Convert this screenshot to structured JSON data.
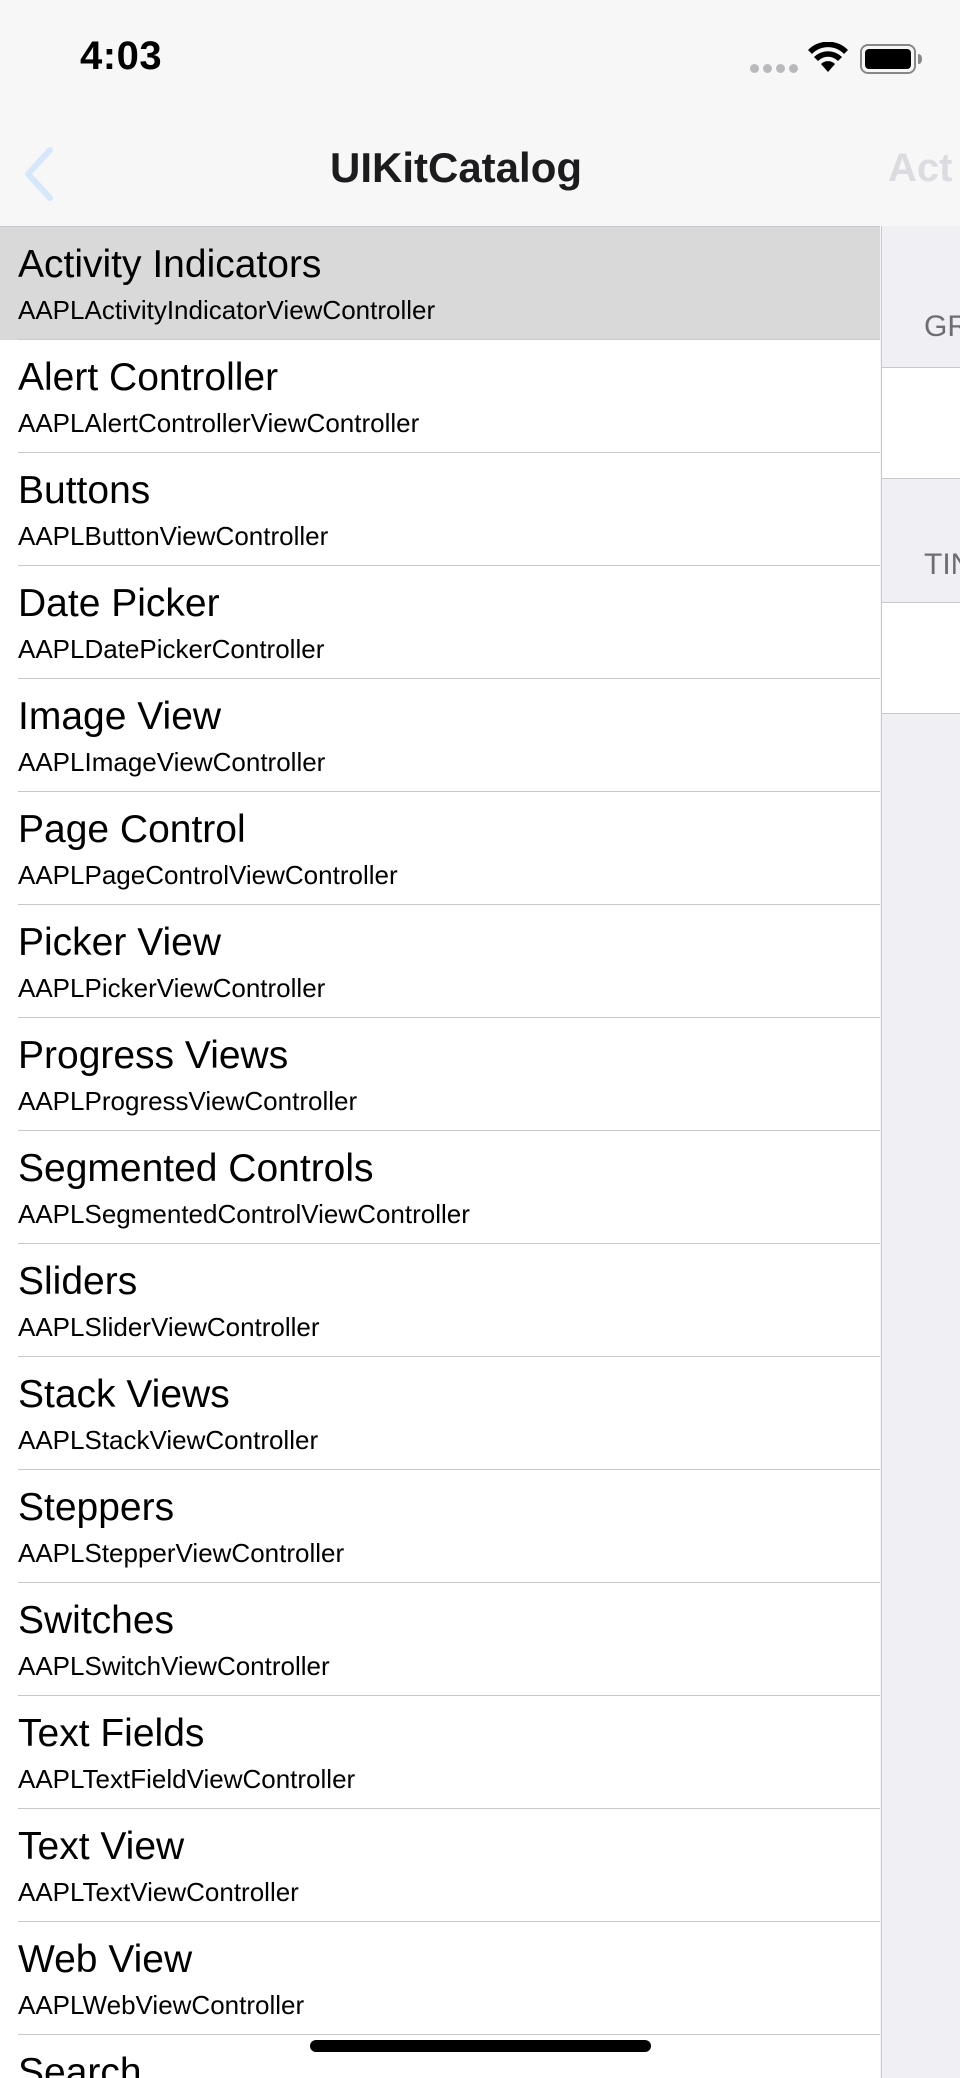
{
  "status_bar": {
    "time": "4:03"
  },
  "nav": {
    "title": "UIKitCatalog",
    "ghost_title": "Act",
    "accent_color": "#007aff"
  },
  "list": [
    {
      "title": "Activity Indicators",
      "subtitle": "AAPLActivityIndicatorViewController",
      "selected": true
    },
    {
      "title": "Alert Controller",
      "subtitle": "AAPLAlertControllerViewController"
    },
    {
      "title": "Buttons",
      "subtitle": "AAPLButtonViewController"
    },
    {
      "title": "Date Picker",
      "subtitle": "AAPLDatePickerController"
    },
    {
      "title": "Image View",
      "subtitle": "AAPLImageViewController"
    },
    {
      "title": "Page Control",
      "subtitle": "AAPLPageControlViewController"
    },
    {
      "title": "Picker View",
      "subtitle": "AAPLPickerViewController"
    },
    {
      "title": "Progress Views",
      "subtitle": "AAPLProgressViewController"
    },
    {
      "title": "Segmented Controls",
      "subtitle": "AAPLSegmentedControlViewController"
    },
    {
      "title": "Sliders",
      "subtitle": "AAPLSliderViewController"
    },
    {
      "title": "Stack Views",
      "subtitle": "AAPLStackViewController"
    },
    {
      "title": "Steppers",
      "subtitle": "AAPLStepperViewController"
    },
    {
      "title": "Switches",
      "subtitle": "AAPLSwitchViewController"
    },
    {
      "title": "Text Fields",
      "subtitle": "AAPLTextFieldViewController"
    },
    {
      "title": "Text View",
      "subtitle": "AAPLTextViewController"
    },
    {
      "title": "Web View",
      "subtitle": "AAPLWebViewController"
    },
    {
      "title": "Search",
      "subtitle": ""
    }
  ],
  "detail": {
    "section_1_header": "GR",
    "section_2_header": "TIN"
  }
}
